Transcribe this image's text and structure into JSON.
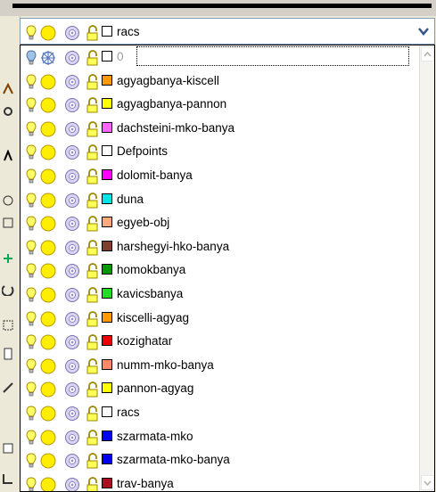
{
  "combo": {
    "current_layer": {
      "name": "racs",
      "color": "#ffffff"
    }
  },
  "icons": {
    "on": "lightbulb-icon",
    "freeze": "sun-icon",
    "plot": "plot-icon",
    "lock": "lock-icon",
    "dropdown": "chevron-down-icon"
  },
  "layers": [
    {
      "name": "0",
      "color": "#ffffff",
      "state": "off"
    },
    {
      "name": "agyagbanya-kiscell",
      "color": "#ff9900",
      "state": "on"
    },
    {
      "name": "agyagbanya-pannon",
      "color": "#ffff00",
      "state": "on"
    },
    {
      "name": "dachsteini-mko-banya",
      "color": "#ff66ff",
      "state": "on"
    },
    {
      "name": "Defpoints",
      "color": "#ffffff",
      "state": "on"
    },
    {
      "name": "dolomit-banya",
      "color": "#ff00ff",
      "state": "on"
    },
    {
      "name": "duna",
      "color": "#00e5e5",
      "state": "on"
    },
    {
      "name": "egyeb-obj",
      "color": "#ffaa77",
      "state": "on"
    },
    {
      "name": "harshegyi-hko-banya",
      "color": "#804030",
      "state": "on"
    },
    {
      "name": "homokbanya",
      "color": "#009900",
      "state": "on"
    },
    {
      "name": "kavicsbanya",
      "color": "#22dd22",
      "state": "on"
    },
    {
      "name": "kiscelli-agyag",
      "color": "#ff9900",
      "state": "on"
    },
    {
      "name": "kozighatar",
      "color": "#ee0000",
      "state": "on"
    },
    {
      "name": "numm-mko-banya",
      "color": "#ff8866",
      "state": "on"
    },
    {
      "name": "pannon-agyag",
      "color": "#ffff00",
      "state": "on"
    },
    {
      "name": "racs",
      "color": "#ffffff",
      "state": "on"
    },
    {
      "name": "szarmata-mko",
      "color": "#0000ee",
      "state": "on"
    },
    {
      "name": "szarmata-mko-banya",
      "color": "#0000ee",
      "state": "on"
    },
    {
      "name": "trav-banya",
      "color": "#aa1020",
      "state": "on"
    }
  ]
}
